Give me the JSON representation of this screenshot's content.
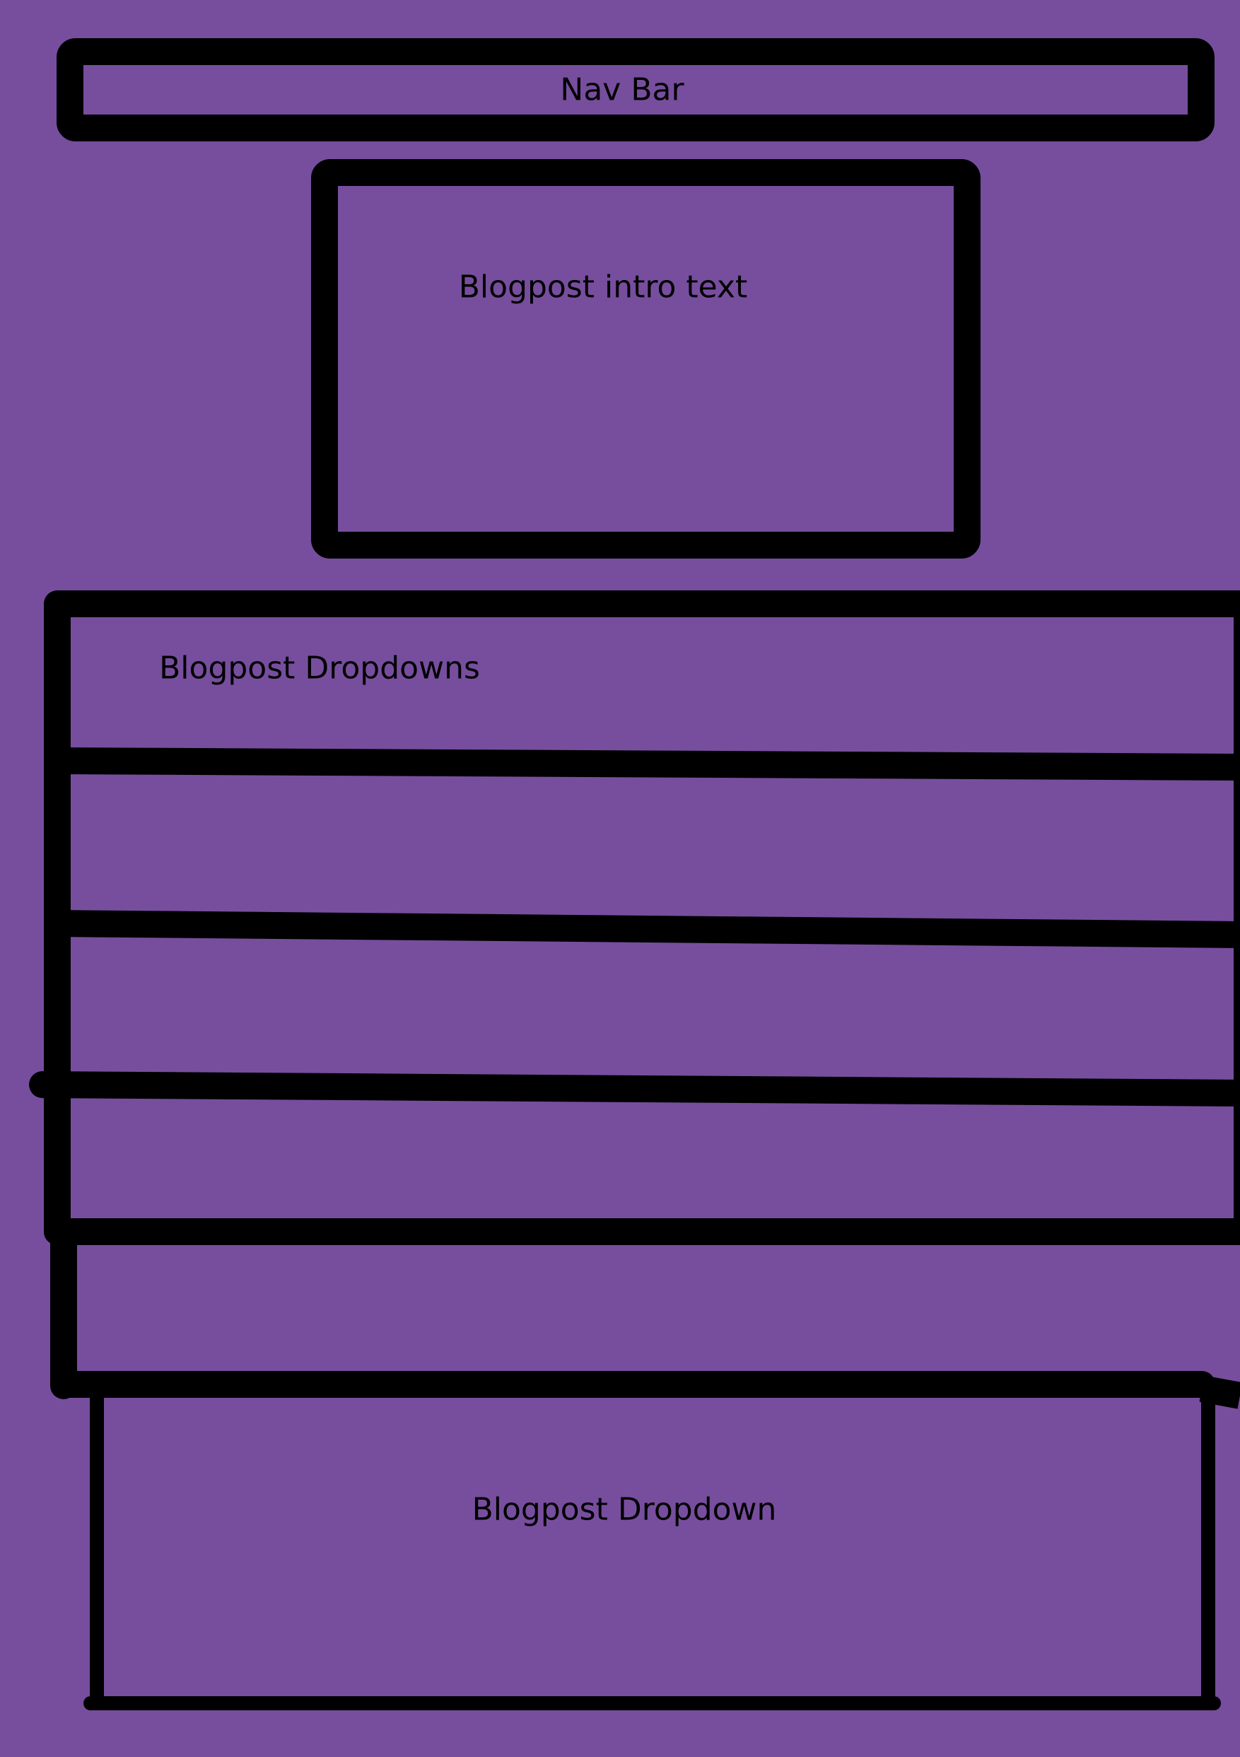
{
  "colors": {
    "background": "#774e9e",
    "stroke": "#000000"
  },
  "nav_bar": {
    "label": "Nav Bar"
  },
  "intro_box": {
    "label": "Blogpost intro text"
  },
  "dropdowns_panel": {
    "label": "Blogpost Dropdowns"
  },
  "dropdown_expanded": {
    "label": "Blogpost Dropdown"
  }
}
